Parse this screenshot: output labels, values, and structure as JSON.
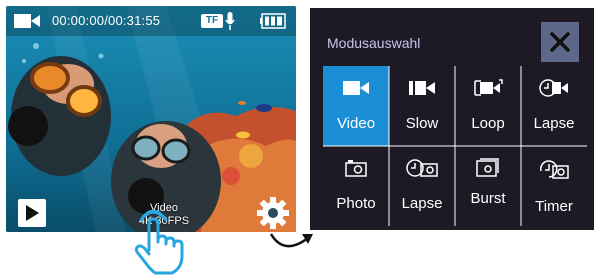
{
  "camera_screen": {
    "timecode": "00:00:00/00:31:55",
    "storage_badge": "TF",
    "mode_name": "Video",
    "mode_spec": "4K 30FPS",
    "icons": {
      "record_mode": "video-camera-icon",
      "microphone": "microphone-icon",
      "battery": "battery-icon",
      "play": "play-icon",
      "settings": "gear-icon"
    }
  },
  "gesture": {
    "hand": "tap-hand-icon",
    "arrow": "curved-arrow-icon"
  },
  "mode_panel": {
    "title": "Modusauswahl",
    "close_icon": "close-icon",
    "selected_color": "#1b8fd6",
    "modes": [
      {
        "label": "Video",
        "icon": "video-camera-icon",
        "selected": true
      },
      {
        "label": "Slow",
        "icon": "slow-motion-icon",
        "selected": false
      },
      {
        "label": "Loop",
        "icon": "loop-recording-icon",
        "selected": false
      },
      {
        "label": "Lapse",
        "icon": "video-lapse-icon",
        "selected": false
      },
      {
        "label": "Photo",
        "icon": "photo-camera-icon",
        "selected": false
      },
      {
        "label": "Lapse",
        "icon": "photo-lapse-icon",
        "selected": false
      },
      {
        "label": "Burst",
        "icon": "burst-icon",
        "selected": false
      },
      {
        "label": "Timer",
        "icon": "timer-icon",
        "selected": false
      }
    ]
  }
}
